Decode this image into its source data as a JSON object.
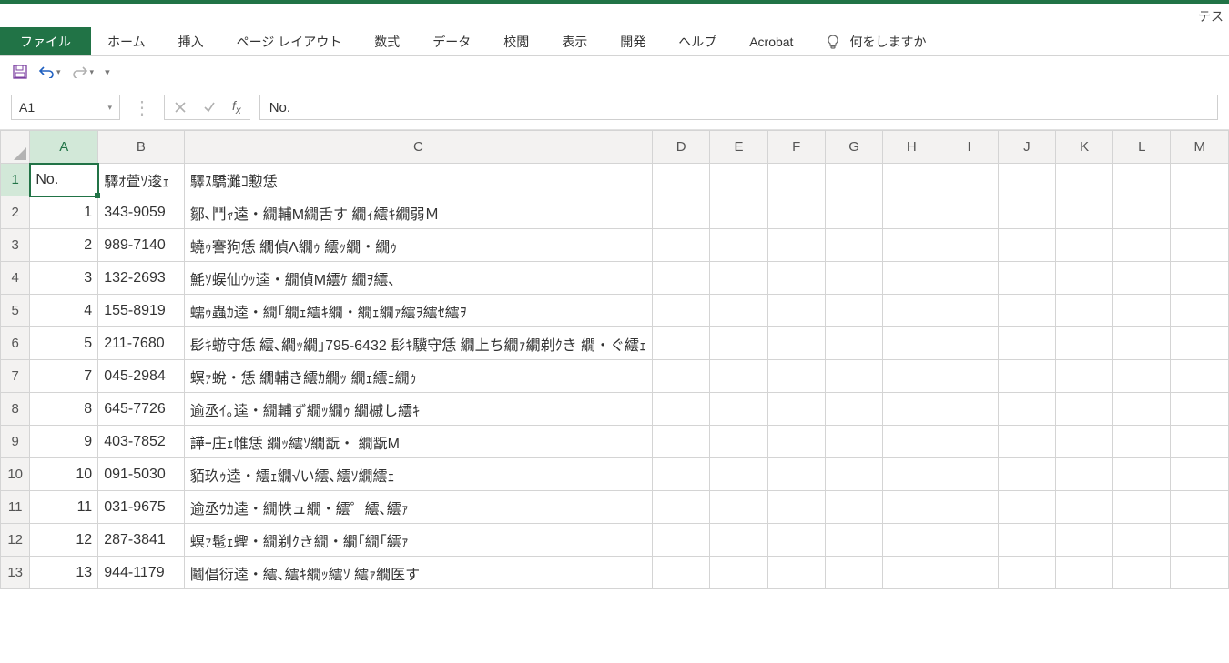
{
  "title_partial": "テス",
  "tabs": {
    "file": "ファイル",
    "home": "ホーム",
    "insert": "挿入",
    "page_layout": "ページ レイアウト",
    "formulas": "数式",
    "data": "データ",
    "review": "校閲",
    "view": "表示",
    "developer": "開発",
    "help": "ヘルプ",
    "acrobat": "Acrobat",
    "tell_me": "何をしますか"
  },
  "name_box": "A1",
  "formula_value": "No.",
  "columns": [
    "A",
    "B",
    "C",
    "D",
    "E",
    "F",
    "G",
    "H",
    "I",
    "J",
    "K",
    "L",
    "M"
  ],
  "row_numbers": [
    1,
    2,
    3,
    4,
    5,
    6,
    7,
    8,
    9,
    10,
    11,
    12,
    13
  ],
  "cells": {
    "r1": {
      "a": "No.",
      "b": "驛ｵ萓ｿ逡ｪ",
      "c": "驛ｽ驕灘ｺ懃恁"
    },
    "r2": {
      "a": "1",
      "b": "343-9059",
      "c": "鄒､鬥ｬ逵・繝輔Μ繝舌す 繝ｨ繧ｷ繝弱Ｍ"
    },
    "r3": {
      "a": "2",
      "b": "989-7140",
      "c": "蟯ｩ謇狗恁 繝偵Λ繝ｩ 繧ｯ繝・繝ｩ"
    },
    "r4": {
      "a": "3",
      "b": "132-2693",
      "c": "魹ｿ蜈仙ｳｯ逵・繝偵Μ繧ｹ 繝ｦ繧､"
    },
    "r5": {
      "a": "4",
      "b": "155-8919",
      "c": "蠕ｩ蟲ｶ逵・繝｢繝ｪ繧ｷ繝・繝ｪ繝ｧ繧ｦ繧ｾ繧ｦ"
    },
    "r6": {
      "a": "5",
      "b": "211-7680",
      "c": "髟ｷ蝣守恁 繧､繝ｯ繝｣795-6432 髟ｷ驥守恁 繝上ち繝ｧ繝剃ｸき 繝・ぐ繧ｪ"
    },
    "r7": {
      "a": "7",
      "b": "045-2984",
      "c": "螟ｧ蛻・恁 繝輔き繧ｶ繝ｯ 繝ｪ繧ｪ繝ｩ"
    },
    "r8": {
      "a": "8",
      "b": "645-7726",
      "c": "逾丞ｲ｡逵・繝輔ず繝ｯ繝ｩ 繝槭し繧ｷ"
    },
    "r9": {
      "a": "9",
      "b": "403-7852",
      "c": "譁ｰ庄ｪ帷恁 繝ｯ繧ｿ繝翫・ 繝翫Μ"
    },
    "r10": {
      "a": "10",
      "b": "091-5030",
      "c": "貊玖ｩ逵・繧ｪ繝√い繧､繧ｿ繝繧ｪ"
    },
    "r11": {
      "a": "11",
      "b": "031-9675",
      "c": "逾丞ｳｶ逵・繝帙ュ繝・繧゜繧､繧ｧ"
    },
    "r12": {
      "a": "12",
      "b": "287-3841",
      "c": "螟ｧ髢ｪ蟶・繝剃ｸき繝・繝｢繝｢繧ｧ"
    },
    "r13": {
      "a": "13",
      "b": "944-1179",
      "c": "鬮倡衍逵・繧､繧ｷ繝ｯ繧ｿ 繧ｧ繝医す"
    }
  }
}
